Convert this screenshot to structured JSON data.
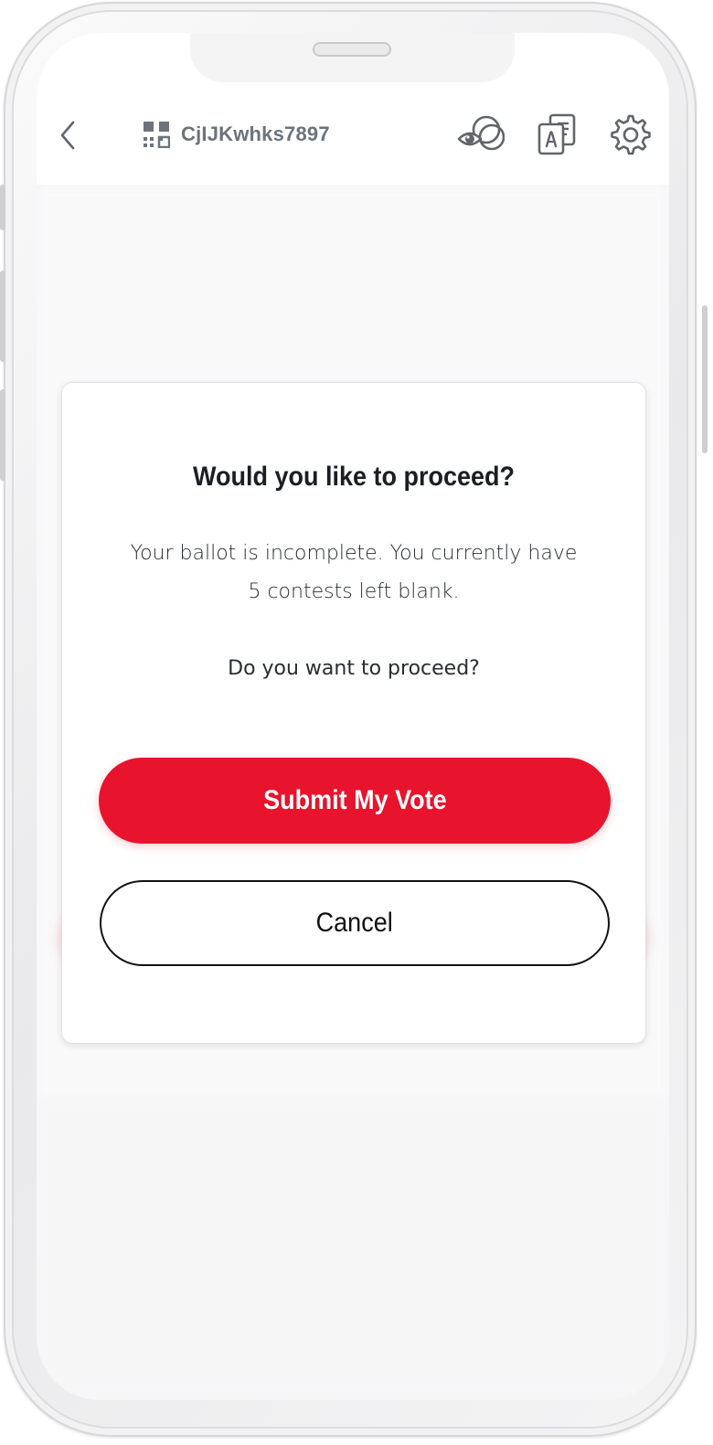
{
  "header": {
    "session_id": "CjIJKwhks7897",
    "icons": [
      "back-icon",
      "qr-code-icon",
      "view-icon",
      "translate-icon",
      "gear-icon"
    ]
  },
  "modal": {
    "title": "Would you like to proceed?",
    "body_line1": "Your ballot is incomplete.  You currently have",
    "body_line2": "5 contests left blank.",
    "question": "Do you want to proceed?",
    "submit_label": "Submit My Vote",
    "cancel_label": "Cancel"
  },
  "colors": {
    "accent": "#e8132d",
    "text_primary": "#1b1f24",
    "header_text": "#3b4550",
    "background": "#f3f3f5"
  }
}
